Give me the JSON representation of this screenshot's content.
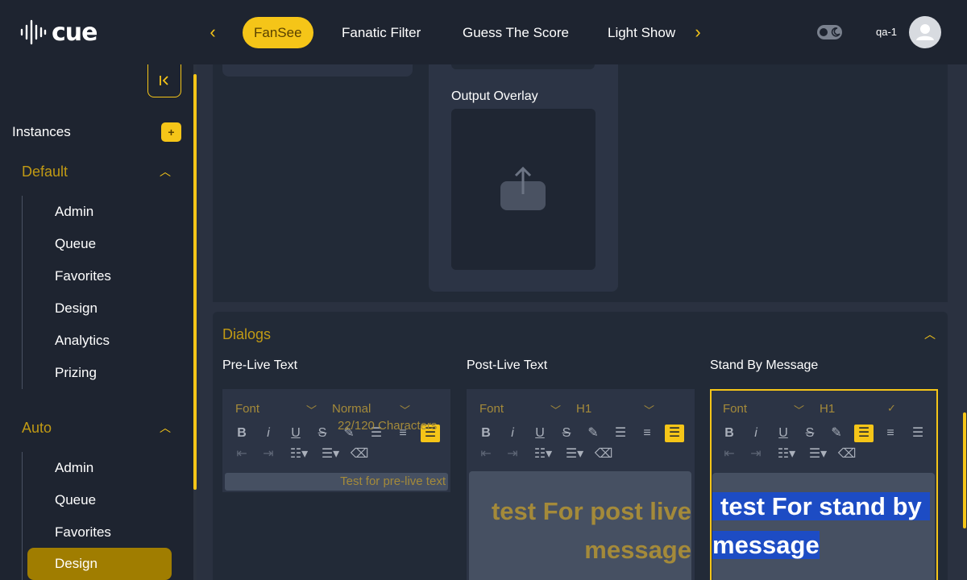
{
  "app": {
    "logo_text": "cue",
    "user_name": "qa-1"
  },
  "tabs": [
    "FanSee",
    "Fanatic Filter",
    "Guess The Score",
    "Light Show"
  ],
  "sidebar": {
    "instances_label": "Instances",
    "add_label": "+",
    "groups": [
      {
        "title": "Default",
        "items": [
          "Admin",
          "Queue",
          "Favorites",
          "Design",
          "Analytics",
          "Prizing"
        ]
      },
      {
        "title": "Auto",
        "items": [
          "Admin",
          "Queue",
          "Favorites",
          "Design"
        ],
        "active": "Design"
      }
    ]
  },
  "main": {
    "output_overlay_label": "Output Overlay",
    "dialogs": {
      "title": "Dialogs",
      "pre_live": {
        "label": "Pre-Live Text",
        "font": "Font",
        "size": "Normal",
        "text": "Test for pre-live text",
        "char_count": "22/120 Characters"
      },
      "post_live": {
        "label": "Post-Live Text",
        "font": "Font",
        "size": "H1",
        "text": "test For post live message"
      },
      "stand_by": {
        "label": "Stand By Message",
        "font": "Font",
        "size": "H1",
        "line1": "test For stand by",
        "line2": "message"
      }
    }
  },
  "colors": {
    "accent": "#f5c518",
    "bg": "#1e2430",
    "panel": "#2a3140",
    "selection": "#1d4cc4"
  }
}
